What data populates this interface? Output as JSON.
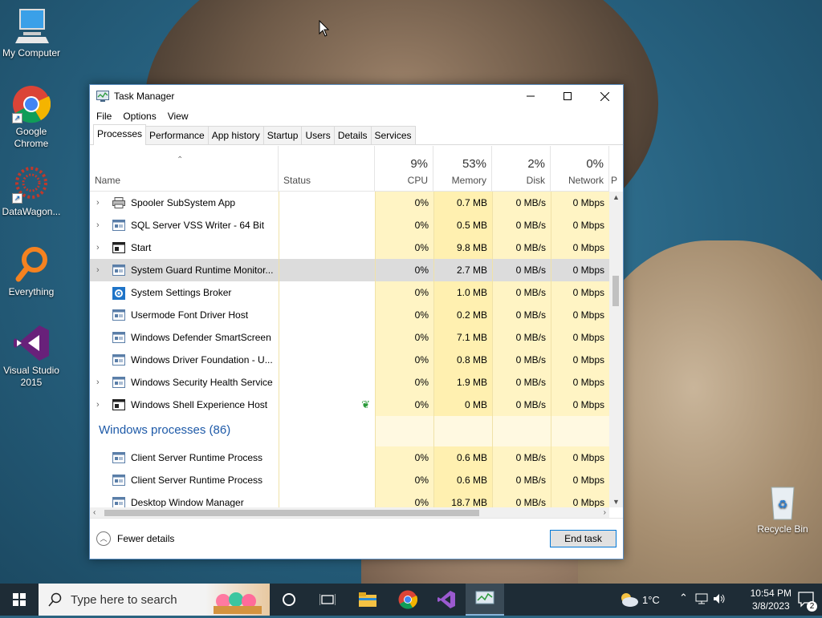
{
  "desktop": {
    "icons": [
      {
        "label": "My Computer"
      },
      {
        "label": "Google Chrome"
      },
      {
        "label": "DataWagon..."
      },
      {
        "label": "Everything"
      },
      {
        "label": "Visual Studio 2015"
      },
      {
        "label": "Recycle Bin"
      }
    ]
  },
  "window": {
    "title": "Task Manager",
    "menu": [
      "File",
      "Options",
      "View"
    ],
    "tabs": [
      "Processes",
      "Performance",
      "App history",
      "Startup",
      "Users",
      "Details",
      "Services"
    ],
    "active_tab": "Processes"
  },
  "columns": {
    "name": "Name",
    "status": "Status",
    "cpu": {
      "pct": "9%",
      "label": "CPU"
    },
    "memory": {
      "pct": "53%",
      "label": "Memory"
    },
    "disk": {
      "pct": "2%",
      "label": "Disk"
    },
    "network": {
      "pct": "0%",
      "label": "Network"
    },
    "power": "P"
  },
  "rows": [
    {
      "name": "Spooler SubSystem App",
      "cpu": "0%",
      "mem": "0.7 MB",
      "disk": "0 MB/s",
      "net": "0 Mbps"
    },
    {
      "name": "SQL Server VSS Writer - 64 Bit",
      "cpu": "0%",
      "mem": "0.5 MB",
      "disk": "0 MB/s",
      "net": "0 Mbps"
    },
    {
      "name": "Start",
      "cpu": "0%",
      "mem": "9.8 MB",
      "disk": "0 MB/s",
      "net": "0 Mbps"
    },
    {
      "name": "System Guard Runtime Monitor...",
      "cpu": "0%",
      "mem": "2.7 MB",
      "disk": "0 MB/s",
      "net": "0 Mbps"
    },
    {
      "name": "System Settings Broker",
      "cpu": "0%",
      "mem": "1.0 MB",
      "disk": "0 MB/s",
      "net": "0 Mbps"
    },
    {
      "name": "Usermode Font Driver Host",
      "cpu": "0%",
      "mem": "0.2 MB",
      "disk": "0 MB/s",
      "net": "0 Mbps"
    },
    {
      "name": "Windows Defender SmartScreen",
      "cpu": "0%",
      "mem": "7.1 MB",
      "disk": "0 MB/s",
      "net": "0 Mbps"
    },
    {
      "name": "Windows Driver Foundation - U...",
      "cpu": "0%",
      "mem": "0.8 MB",
      "disk": "0 MB/s",
      "net": "0 Mbps"
    },
    {
      "name": "Windows Security Health Service",
      "cpu": "0%",
      "mem": "1.9 MB",
      "disk": "0 MB/s",
      "net": "0 Mbps"
    },
    {
      "name": "Windows Shell Experience Host",
      "cpu": "0%",
      "mem": "0 MB",
      "disk": "0 MB/s",
      "net": "0 Mbps"
    }
  ],
  "group": {
    "title": "Windows processes (86)"
  },
  "group_rows": [
    {
      "name": "Client Server Runtime Process",
      "cpu": "0%",
      "mem": "0.6 MB",
      "disk": "0 MB/s",
      "net": "0 Mbps"
    },
    {
      "name": "Client Server Runtime Process",
      "cpu": "0%",
      "mem": "0.6 MB",
      "disk": "0 MB/s",
      "net": "0 Mbps"
    },
    {
      "name": "Desktop Window Manager",
      "cpu": "0%",
      "mem": "18.7 MB",
      "disk": "0 MB/s",
      "net": "0 Mbps"
    }
  ],
  "footer": {
    "fewer_details": "Fewer details",
    "end_task": "End task"
  },
  "taskbar": {
    "search_placeholder": "Type here to search",
    "weather": "1°C",
    "time": "10:54 PM",
    "date": "3/8/2023",
    "notifications": "2"
  }
}
